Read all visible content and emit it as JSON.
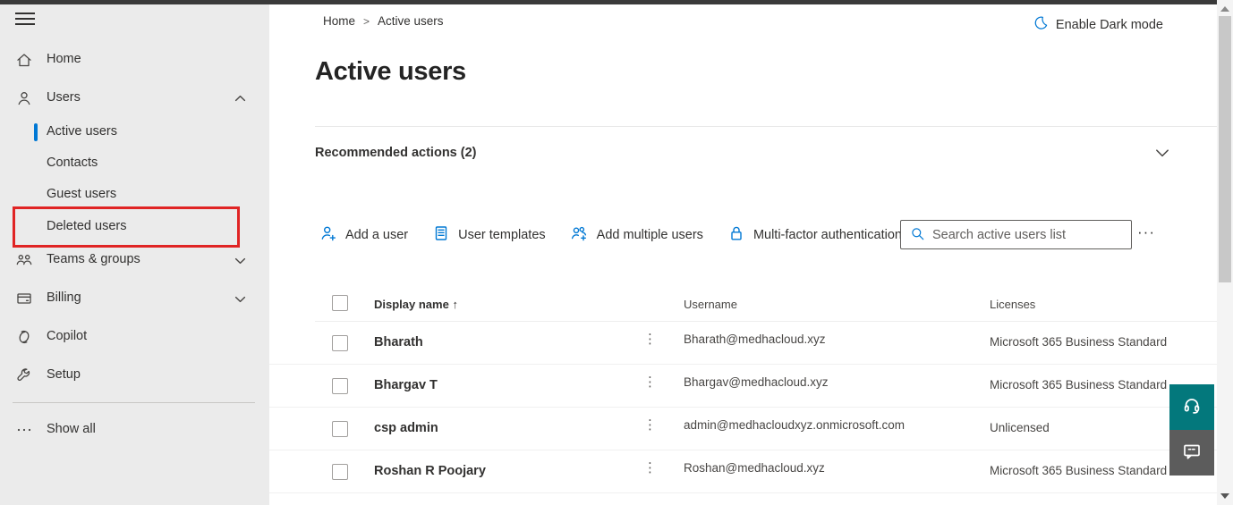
{
  "colors": {
    "accent_blue": "#0078d4",
    "annotation_red": "#e02424",
    "support_teal": "#03787c",
    "feedback_gray": "#5c5c5c",
    "sidebar_bg": "#ebebeb"
  },
  "sidebar": {
    "items": [
      {
        "label": "Home"
      },
      {
        "label": "Users"
      },
      {
        "label": "Active users"
      },
      {
        "label": "Contacts"
      },
      {
        "label": "Guest users"
      },
      {
        "label": "Deleted users"
      },
      {
        "label": "Teams & groups"
      },
      {
        "label": "Billing"
      },
      {
        "label": "Copilot"
      },
      {
        "label": "Setup"
      },
      {
        "label": "Show all"
      }
    ]
  },
  "header": {
    "breadcrumb": {
      "home": "Home",
      "sep": ">",
      "current": "Active users"
    },
    "dark_mode_label": "Enable Dark mode",
    "title": "Active users"
  },
  "recommended": {
    "label": "Recommended actions (2)"
  },
  "toolbar": {
    "actions": [
      {
        "label": "Add a user"
      },
      {
        "label": "User templates"
      },
      {
        "label": "Add multiple users"
      },
      {
        "label": "Multi-factor authentication"
      }
    ],
    "search_placeholder": "Search active users list",
    "more_label": "···"
  },
  "table": {
    "columns": {
      "display_name": "Display name",
      "username": "Username",
      "licenses": "Licenses"
    },
    "sort_glyph": "↑",
    "kebab_glyph": "⋮",
    "rows": [
      {
        "display_name": "Bharath",
        "username": "Bharath@medhacloud.xyz",
        "licenses": "Microsoft 365 Business Standard"
      },
      {
        "display_name": "Bhargav T",
        "username": "Bhargav@medhacloud.xyz",
        "licenses": "Microsoft 365 Business Standard"
      },
      {
        "display_name": "csp admin",
        "username": "admin@medhacloudxyz.onmicrosoft.com",
        "licenses": "Unlicensed"
      },
      {
        "display_name": "Roshan R Poojary",
        "username": "Roshan@medhacloud.xyz",
        "licenses": "Microsoft 365 Business Standard"
      }
    ]
  }
}
